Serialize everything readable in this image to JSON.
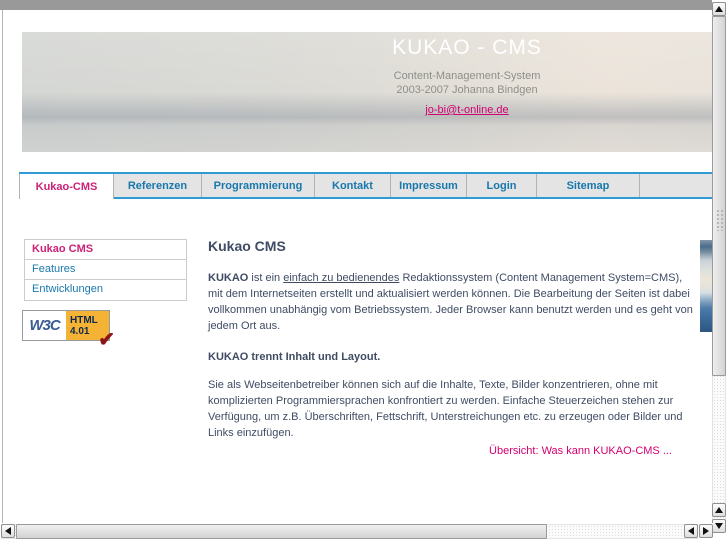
{
  "header": {
    "title": "KUKAO - CMS",
    "subtitle1": "Content-Management-System",
    "subtitle2": "2003-2007 Johanna Bindgen",
    "email": "jo-bi@t-online.de"
  },
  "nav": {
    "tabs": [
      {
        "label": "Kukao-CMS",
        "active": true
      },
      {
        "label": "Referenzen",
        "active": false
      },
      {
        "label": "Programmierung",
        "active": false
      },
      {
        "label": "Kontakt",
        "active": false
      },
      {
        "label": "Impressum",
        "active": false
      },
      {
        "label": "Login",
        "active": false
      },
      {
        "label": "Sitemap",
        "active": false
      }
    ]
  },
  "sidebar": {
    "items": [
      {
        "label": "Kukao CMS",
        "active": true
      },
      {
        "label": "Features",
        "active": false
      },
      {
        "label": "Entwicklungen",
        "active": false
      }
    ],
    "badge": {
      "logo": "W3C",
      "line1": "HTML",
      "line2": "4.01"
    }
  },
  "main": {
    "heading": "Kukao CMS",
    "p1_lead": "KUKAO",
    "p1_pre_link": " ist ein ",
    "p1_link": "einfach zu bedienendes",
    "p1_rest": " Redaktionssystem (Content Management System=CMS), mit dem Internetseiten erstellt und aktualisiert werden können. Die Bearbeitung der Seiten ist dabei vollkommen unabhängig vom Betriebssystem. Jeder Browser kann benutzt werden und es geht von jedem Ort aus.",
    "subheading": "KUKAO trennt Inhalt und Layout.",
    "p2": "Sie als Webseitenbetreiber können sich auf die Inhalte, Texte, Bilder konzentrieren, ohne mit komplizierten Programmiersprachen konfrontiert zu werden. Einfache Steuerzeichen stehen zur Verfügung, um z.B. Überschriften, Fettschrift, Unterstreichungen etc. zu erzeugen oder Bilder und Links einzufügen.",
    "more_link": "Übersicht: Was kann KUKAO-CMS ..."
  },
  "icons": {
    "checkmark-icon": "✔",
    "scroll-up-icon": "triangle-up",
    "scroll-down-icon": "triangle-down",
    "scroll-left-icon": "triangle-left",
    "scroll-right-icon": "triangle-right"
  },
  "colors": {
    "accent_blue": "#2f9ad4",
    "link_blue": "#1878ad",
    "magenta": "#d4006f",
    "text": "#3f4c63",
    "badge_orange": "#f5b335"
  }
}
